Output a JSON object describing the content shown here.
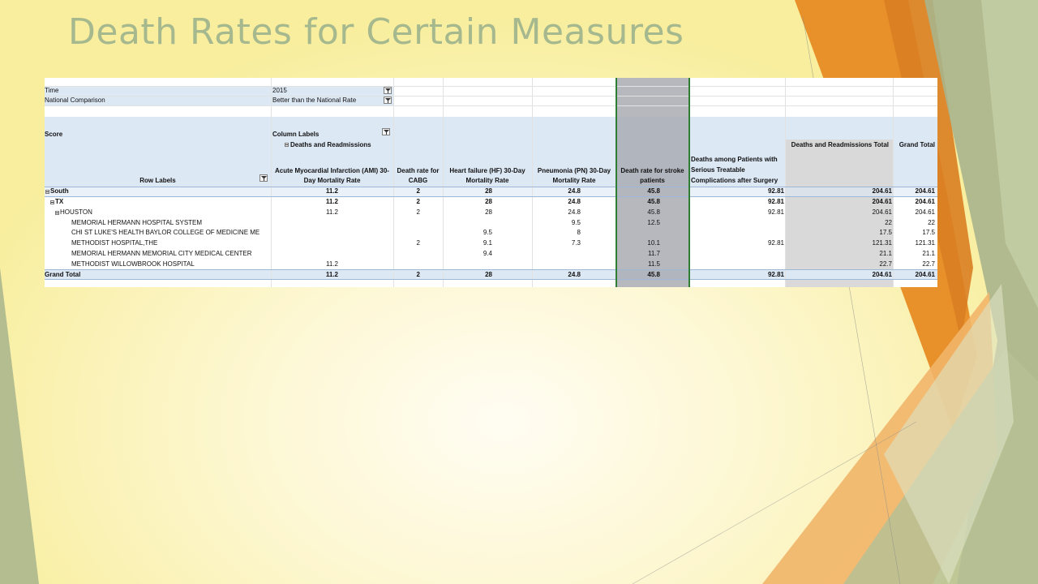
{
  "slide": {
    "title": "Death Rates for Certain Measures"
  },
  "filters": [
    {
      "label": "Time",
      "value": "2015"
    },
    {
      "label": "National Comparison",
      "value": "Better than the National Rate"
    }
  ],
  "pivot": {
    "values_label": "Score",
    "column_labels": "Column Labels",
    "group_label": "Deaths and Readmissions",
    "row_labels_header": "Row Labels",
    "headers": {
      "ami": [
        "Acute Myocardial Infarction (AMI) 30-",
        "Day Mortality Rate"
      ],
      "cabg": [
        "Death rate for",
        "CABG"
      ],
      "hf": [
        "Heart failure (HF) 30-Day",
        "Mortality Rate"
      ],
      "pn": [
        "Pneumonia (PN) 30-Day",
        "Mortality Rate"
      ],
      "stroke": [
        "Death rate for stroke",
        "patients"
      ],
      "surgery": [
        "Deaths among Patients with",
        "Serious Treatable",
        "Complications after Surgery"
      ],
      "group_total": "Deaths and Readmissions Total",
      "grand_total": "Grand Total"
    },
    "rows": [
      {
        "label": "South",
        "ami": "11.2",
        "cabg": "2",
        "hf": "28",
        "pn": "24.8",
        "stroke": "45.8",
        "surgery": "92.81",
        "group_total": "204.61",
        "grand_total": "204.61"
      },
      {
        "label": "TX",
        "ami": "11.2",
        "cabg": "2",
        "hf": "28",
        "pn": "24.8",
        "stroke": "45.8",
        "surgery": "92.81",
        "group_total": "204.61",
        "grand_total": "204.61"
      },
      {
        "label": "HOUSTON",
        "ami": "11.2",
        "cabg": "2",
        "hf": "28",
        "pn": "24.8",
        "stroke": "45.8",
        "surgery": "92.81",
        "group_total": "204.61",
        "grand_total": "204.61"
      },
      {
        "label": "MEMORIAL HERMANN HOSPITAL SYSTEM",
        "ami": "",
        "cabg": "",
        "hf": "",
        "pn": "9.5",
        "stroke": "12.5",
        "surgery": "",
        "group_total": "22",
        "grand_total": "22"
      },
      {
        "label": "CHI ST LUKE'S HEALTH BAYLOR COLLEGE OF MEDICINE ME",
        "ami": "",
        "cabg": "",
        "hf": "9.5",
        "pn": "8",
        "stroke": "",
        "surgery": "",
        "group_total": "17.5",
        "grand_total": "17.5"
      },
      {
        "label": "METHODIST HOSPITAL,THE",
        "ami": "",
        "cabg": "2",
        "hf": "9.1",
        "pn": "7.3",
        "stroke": "10.1",
        "surgery": "92.81",
        "group_total": "121.31",
        "grand_total": "121.31"
      },
      {
        "label": "MEMORIAL HERMANN MEMORIAL CITY MEDICAL CENTER",
        "ami": "",
        "cabg": "",
        "hf": "9.4",
        "pn": "",
        "stroke": "11.7",
        "surgery": "",
        "group_total": "21.1",
        "grand_total": "21.1"
      },
      {
        "label": "METHODIST WILLOWBROOK HOSPITAL",
        "ami": "11.2",
        "cabg": "",
        "hf": "",
        "pn": "",
        "stroke": "11.5",
        "surgery": "",
        "group_total": "22.7",
        "grand_total": "22.7"
      },
      {
        "label": "Grand Total",
        "ami": "11.2",
        "cabg": "2",
        "hf": "28",
        "pn": "24.8",
        "stroke": "45.8",
        "surgery": "92.81",
        "group_total": "204.61",
        "grand_total": "204.61"
      }
    ]
  },
  "colors": {
    "title": "#a6b88e",
    "pivot_header_fill": "#dde8f5",
    "total_column_fill": "#d9d9d9",
    "selected_column_fill": "#a9acb3",
    "selection_border": "#2e7d32",
    "accent_orange": "#e8902a",
    "accent_sage": "#a8b48c"
  }
}
